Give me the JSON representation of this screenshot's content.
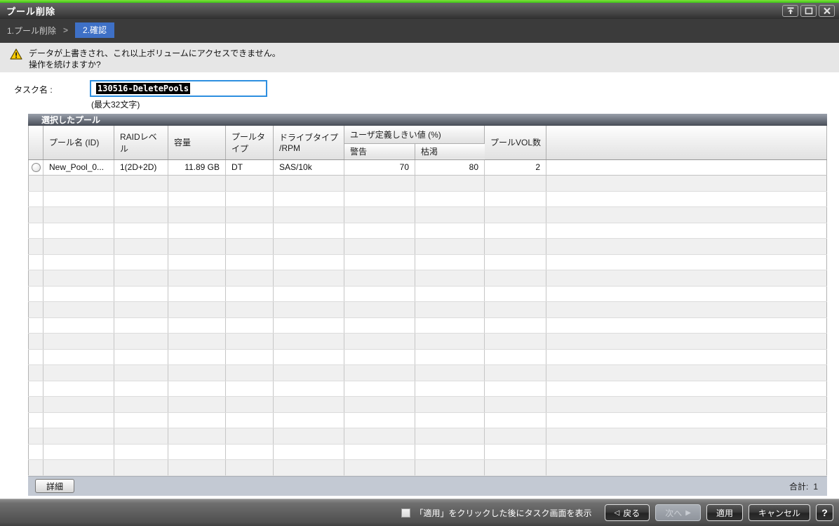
{
  "window": {
    "title": "プール削除"
  },
  "breadcrumb": {
    "step1": "1.プール削除",
    "separator": ">",
    "step2": "2.確認"
  },
  "warning": {
    "line1": "データが上書きされ、これ以上ボリュームにアクセスできません。",
    "line2": "操作を続けますか?"
  },
  "task": {
    "label": "タスク名 :",
    "value": "130516-DeletePools",
    "hint": "(最大32文字)"
  },
  "table": {
    "title": "選択したプール",
    "headers": {
      "pool_name": "プール名 (ID)",
      "raid_level": "RAIDレベル",
      "capacity": "容量",
      "pool_type": "プールタイプ",
      "drive_type": "ドライブタイプ /RPM",
      "threshold_group": "ユーザ定義しきい値 (%)",
      "warning": "警告",
      "depletion": "枯渇",
      "pool_vols": "プールVOL数"
    },
    "rows": [
      {
        "cells": [
          "New_Pool_0...",
          "1(2D+2D)",
          "11.89 GB",
          "DT",
          "SAS/10k",
          "70",
          "80",
          "2"
        ]
      }
    ],
    "detail_button": "詳細",
    "total_label": "合計:",
    "total_value": "1"
  },
  "action_bar": {
    "checkbox_label": "「適用」をクリックした後にタスク画面を表示",
    "back": "戻る",
    "next": "次へ",
    "apply": "適用",
    "cancel": "キャンセル",
    "help": "?"
  },
  "icons": {
    "back_arrow": "◁",
    "next_arrow": "▶"
  },
  "colors": {
    "accent_green": "#4cc81e",
    "breadcrumb_highlight": "#3e70c6",
    "focus_blue": "#2d8fe0",
    "warning_yellow": "#ffcc00"
  }
}
